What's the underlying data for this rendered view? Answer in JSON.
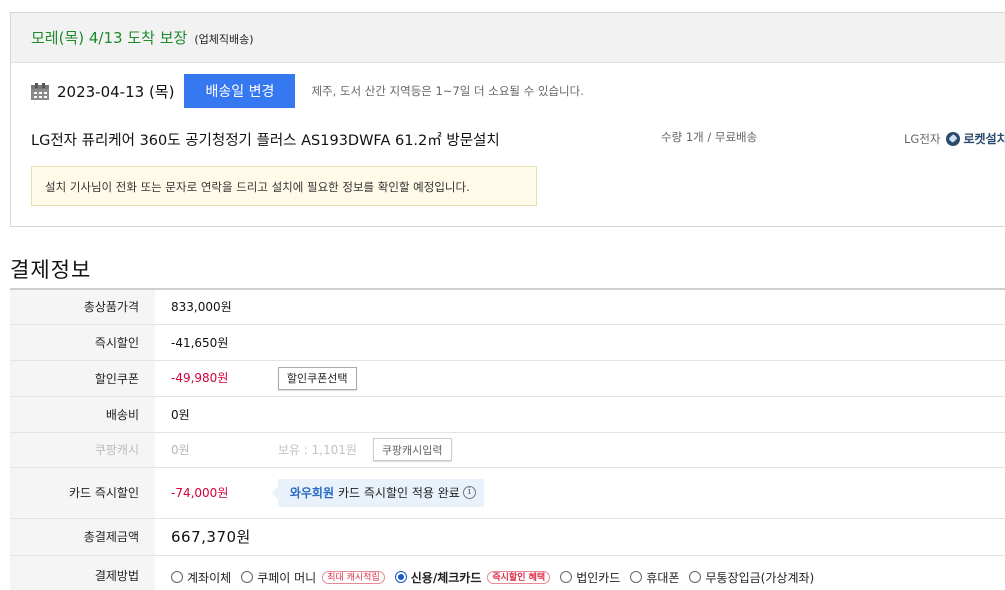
{
  "shipping": {
    "arrival_heading": "모레(목) 4/13 도착 보장",
    "vendor_note": "(업체직배송)",
    "date": "2023-04-13 (목)",
    "change_button": "배송일 변경",
    "date_note": "제주, 도서 산간 지역등은 1~7일 더 소요될 수 있습니다.",
    "product_name": "LG전자 퓨리케어 360도 공기청정기 플러스 AS193DWFA 61.2㎡ 방문설치",
    "quantity": "수량 1개 / 무료배송",
    "seller": "LG전자",
    "rocket_label": "로켓설치",
    "install_notice": "설치 기사님이 전화 또는 문자로 연락을 드리고 설치에 필요한 정보를 확인할 예정입니다."
  },
  "payment": {
    "title": "결제정보",
    "rows": {
      "total_price": {
        "label": "총상품가격",
        "value": "833,000원"
      },
      "instant_discount": {
        "label": "즉시할인",
        "value": "-41,650원"
      },
      "coupon": {
        "label": "할인쿠폰",
        "value": "-49,980원",
        "button": "할인쿠폰선택"
      },
      "delivery_fee": {
        "label": "배송비",
        "value": "0원"
      },
      "coupang_cash": {
        "label": "쿠팡캐시",
        "value": "0원",
        "balance": "보유 : 1,101원",
        "button": "쿠팡캐시입력"
      },
      "card_discount": {
        "label": "카드 즉시할인",
        "value": "-74,000원",
        "wow_member": "와우회원",
        "wow_text": "카드 즉시할인 적용 완료",
        "info_glyph": "i"
      },
      "total_payment": {
        "label": "총결제금액",
        "value": "667,370원"
      },
      "method": {
        "label": "결제방법"
      }
    },
    "methods": [
      {
        "label": "계좌이체",
        "selected": false,
        "tag": ""
      },
      {
        "label": "쿠페이 머니",
        "selected": false,
        "tag": "최대 캐시적립"
      },
      {
        "label": "신용/체크카드",
        "selected": true,
        "tag": "즉시할인 혜택"
      },
      {
        "label": "법인카드",
        "selected": false,
        "tag": ""
      },
      {
        "label": "휴대폰",
        "selected": false,
        "tag": ""
      },
      {
        "label": "무통장입금(가상계좌)",
        "selected": false,
        "tag": ""
      }
    ]
  },
  "colors": {
    "arrival_green": "#1f8b2c",
    "button_blue": "#3578f0",
    "discount_red": "#d3003a",
    "wow_blue": "#2a6ac4",
    "notice_bg": "#fffbe8"
  },
  "icons": [
    "calendar-icon",
    "rocket-icon",
    "info-icon"
  ]
}
